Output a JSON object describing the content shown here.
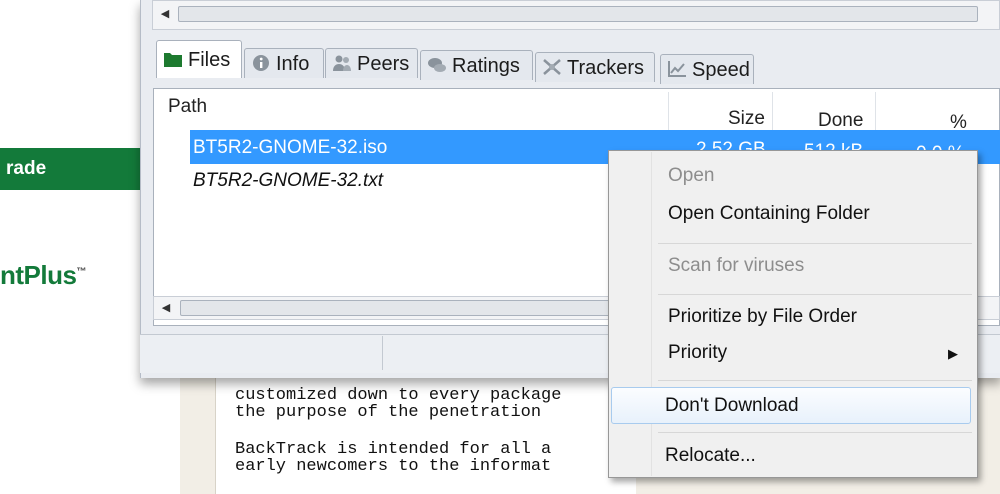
{
  "background_app": {
    "upgrade_text": "rade",
    "brand_text": "ntPlus",
    "brand_mark": "™"
  },
  "tabs": [
    {
      "label": "Files",
      "icon": "folder-icon"
    },
    {
      "label": "Info",
      "icon": "info-icon"
    },
    {
      "label": "Peers",
      "icon": "peers-icon"
    },
    {
      "label": "Ratings",
      "icon": "ratings-icon"
    },
    {
      "label": "Trackers",
      "icon": "trackers-icon"
    },
    {
      "label": "Speed",
      "icon": "speed-icon"
    }
  ],
  "files_table": {
    "columns": [
      "Path",
      "Size",
      "Done",
      "%"
    ],
    "rows": [
      {
        "path": "BT5R2-GNOME-32.iso",
        "size": "2.52 GB",
        "done": "512 kB",
        "percent": "0.0 %",
        "selected": true
      },
      {
        "path": "BT5R2-GNOME-32.txt",
        "size": "",
        "done": "",
        "percent": "",
        "selected": false
      }
    ]
  },
  "context_menu": {
    "items": [
      {
        "label": "Open",
        "disabled": true
      },
      {
        "label": "Open Containing Folder",
        "disabled": false
      },
      {
        "label": "Scan for viruses",
        "disabled": true
      },
      {
        "label": "Prioritize by File Order",
        "disabled": false
      },
      {
        "label": "Priority",
        "disabled": false,
        "has_submenu": true
      },
      {
        "label": "Don't Download",
        "disabled": false,
        "highlighted": true
      },
      {
        "label": "Relocate...",
        "disabled": false
      }
    ],
    "submenu_arrow": "▶"
  },
  "document_lines": [
    "customized down to every package",
    "the purpose of the penetration",
    "BackTrack is intended for all a",
    "early newcomers to the informat"
  ],
  "scroll_arrows": {
    "left": "◀"
  },
  "colors": {
    "selection": "#3399ff",
    "brand_green": "#137a3a",
    "menu_background": "#f0f0f0"
  }
}
